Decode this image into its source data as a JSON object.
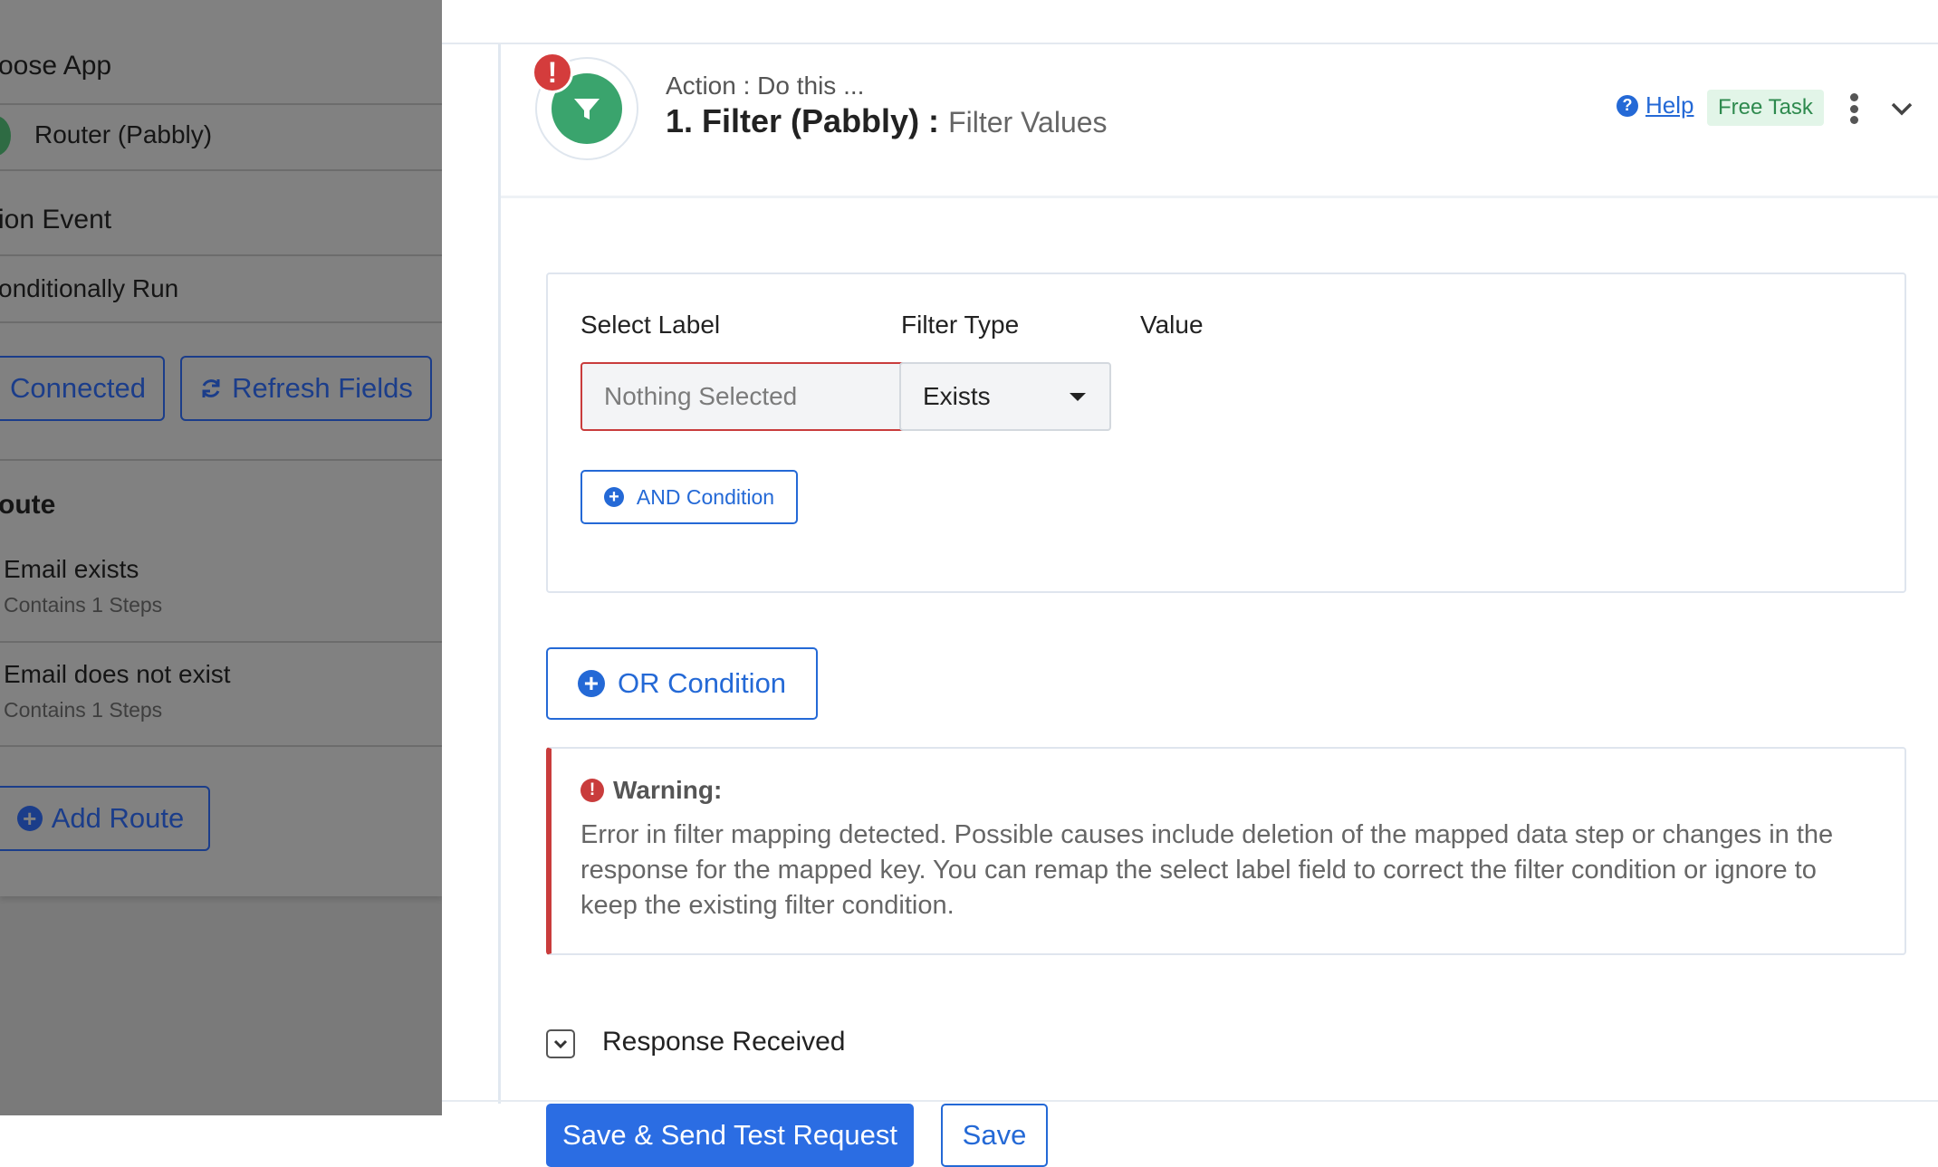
{
  "left_panel": {
    "choose_app_heading": "oose App",
    "app_name": "Router (Pabbly)",
    "action_event_heading": "ion Event",
    "action_event_value": "onditionally Run",
    "connected_label": "Connected",
    "refresh_label": "Refresh Fields",
    "route_heading": "oute",
    "routes": [
      {
        "name": "Email exists",
        "steps": "Contains 1 Steps"
      },
      {
        "name": "Email does not exist",
        "steps": "Contains 1 Steps"
      }
    ],
    "add_route_label": "Add Route"
  },
  "step": {
    "alert_badge": "!",
    "subtitle": "Action : Do this ...",
    "title": "1. Filter (Pabbly) :",
    "event": "Filter Values",
    "help_label": "Help",
    "help_icon_glyph": "?",
    "free_task_label": "Free Task"
  },
  "filter": {
    "select_label_header": "Select Label",
    "filter_type_header": "Filter Type",
    "value_header": "Value",
    "label_placeholder": "Nothing Selected",
    "filter_type_value": "Exists",
    "and_condition_label": "AND Condition",
    "or_condition_label": "OR Condition"
  },
  "warning": {
    "icon_glyph": "!",
    "title": "Warning:",
    "text": "Error in filter mapping detected. Possible causes include deletion of the mapped data step or changes in the response for the mapped key. You can remap the select label field to correct the filter condition or ignore to keep the existing filter condition."
  },
  "response": {
    "label": "Response Received"
  },
  "actions": {
    "save_send_label": "Save & Send Test Request",
    "save_label": "Save"
  },
  "colors": {
    "accent_blue": "#2469d6",
    "primary_button": "#2b6de3",
    "error_red": "#c93c3c",
    "filter_green": "#3aa46d",
    "overlay_gray": "#818181"
  },
  "icons": {
    "filter": "funnel-icon",
    "alert": "exclamation-circle-icon",
    "help": "question-circle-icon",
    "kebab": "vertical-dots-icon",
    "collapse": "chevron-down-icon",
    "plus": "plus-circle-icon",
    "refresh": "refresh-icon"
  }
}
